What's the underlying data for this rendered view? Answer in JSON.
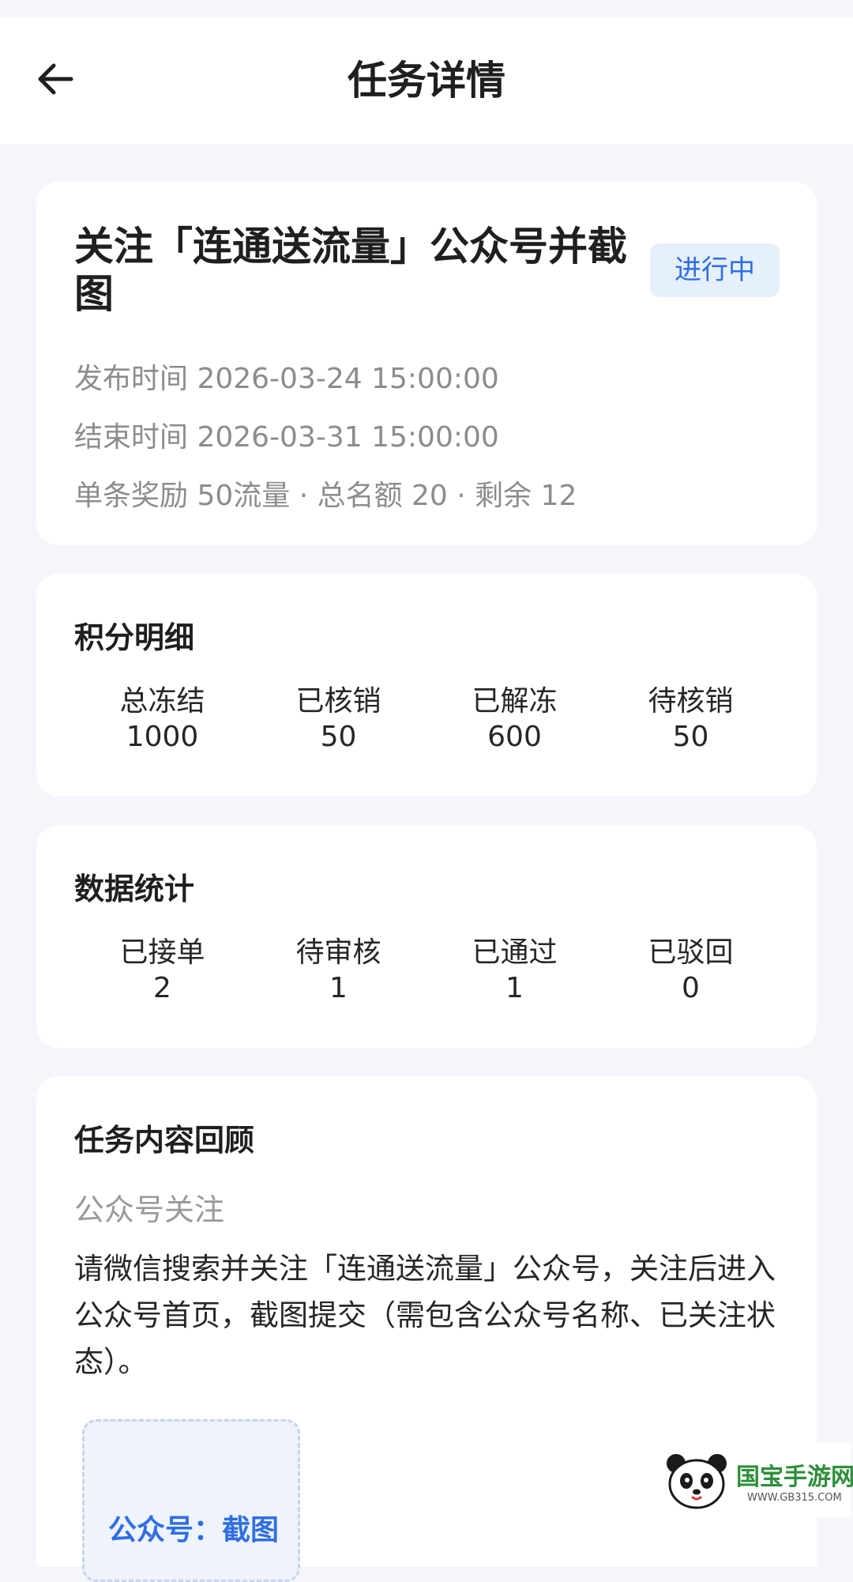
{
  "header": {
    "title": "任务详情",
    "back_icon": "arrow-left-icon"
  },
  "task": {
    "title": "关注「连通送流量」公众号并截图",
    "status": "进行中",
    "publish_time": "发布时间 2026-03-24 15:00:00",
    "end_time": "结束时间 2026-03-31 15:00:00",
    "reward_line": "单条奖励 50流量 · 总名额 20 · 剩余 12"
  },
  "points": {
    "title": "积分明细",
    "items": [
      {
        "label": "总冻结",
        "value": "1000"
      },
      {
        "label": "已核销",
        "value": "50"
      },
      {
        "label": "已解冻",
        "value": "600"
      },
      {
        "label": "待核销",
        "value": "50"
      }
    ]
  },
  "stats": {
    "title": "数据统计",
    "items": [
      {
        "label": "已接单",
        "value": "2"
      },
      {
        "label": "待审核",
        "value": "1"
      },
      {
        "label": "已通过",
        "value": "1"
      },
      {
        "label": "已驳回",
        "value": "0"
      }
    ]
  },
  "review": {
    "title": "任务内容回顾",
    "type": "公众号关注",
    "description": "请微信搜索并关注「连通送流量」公众号，关注后进入公众号首页，截图提交（需包含公众号名称、已关注状态）。",
    "upload_label": "公众号：截图"
  },
  "watermark": {
    "text": "国宝手游网",
    "url": "WWW.GB315.COM"
  },
  "colors": {
    "accent": "#2f6ee3",
    "badge_bg": "#e6f0fd",
    "page_bg": "#f4f6fb"
  }
}
